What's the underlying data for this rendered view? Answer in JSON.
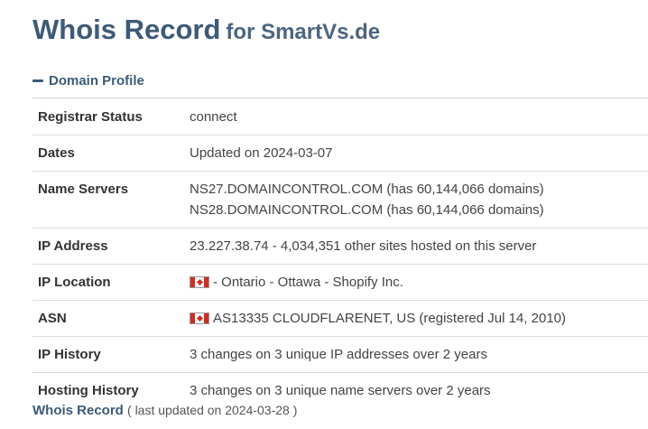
{
  "header": {
    "title_main": "Whois Record",
    "title_for": "for SmartVs.de"
  },
  "section": {
    "toggle_icon": "minus-icon",
    "title": "Domain Profile"
  },
  "rows": [
    {
      "key": "Registrar Status",
      "value": "connect"
    },
    {
      "key": "Dates",
      "value": "Updated on 2024-03-07"
    },
    {
      "key": "Name Servers",
      "line1": "NS27.DOMAINCONTROL.COM (has 60,144,066 domains)",
      "line2": "NS28.DOMAINCONTROL.COM (has 60,144,066 domains)"
    },
    {
      "key": "IP Address",
      "value": "23.227.38.74 - 4,034,351 other sites hosted on this server"
    },
    {
      "key": "IP Location",
      "flag": "canada-flag-icon",
      "value": "- Ontario - Ottawa - Shopify Inc."
    },
    {
      "key": "ASN",
      "flag": "canada-flag-icon",
      "value": "AS13335 CLOUDFLARENET, US (registered Jul 14, 2010)"
    },
    {
      "key": "IP History",
      "value": "3 changes on 3 unique IP addresses over 2 years"
    },
    {
      "key": "Hosting History",
      "value": "3 changes on 3 unique name servers over 2 years"
    }
  ],
  "footer": {
    "title": "Whois Record",
    "subtitle": "( last updated on 2024-03-28 )"
  },
  "colors": {
    "heading": "#3d5a78",
    "text": "#444444",
    "divider": "#dcdcdc"
  }
}
